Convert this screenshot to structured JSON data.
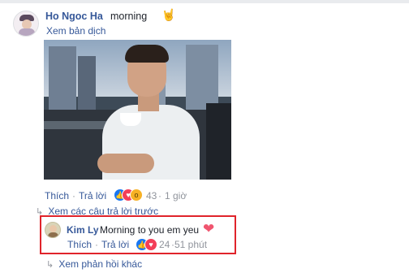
{
  "post": {
    "author": "Ho Ngoc Ha",
    "message": "morning",
    "emoji": "🤘",
    "translate_link": "Xem bản dịch",
    "actions": {
      "like": "Thích",
      "reply": "Trả lời",
      "reaction_count": "43",
      "time": "1 giờ"
    },
    "reactions": [
      "like-icon",
      "love-icon",
      "wow-icon"
    ],
    "previous_replies_link": "Xem các câu trả lời trước"
  },
  "reply": {
    "author": "Kim Ly",
    "message": "Morning to you em yeu",
    "emoji": "❤",
    "actions": {
      "like": "Thích",
      "reply": "Trả lời",
      "reaction_count": "24",
      "time": "51 phút"
    },
    "reactions": [
      "like-icon",
      "love-icon"
    ],
    "highlight_color": "#e0242b"
  },
  "more_replies_link": "Xem phản hồi khác",
  "colors": {
    "link": "#365899",
    "meta": "#90949c",
    "text": "#1d2129"
  }
}
